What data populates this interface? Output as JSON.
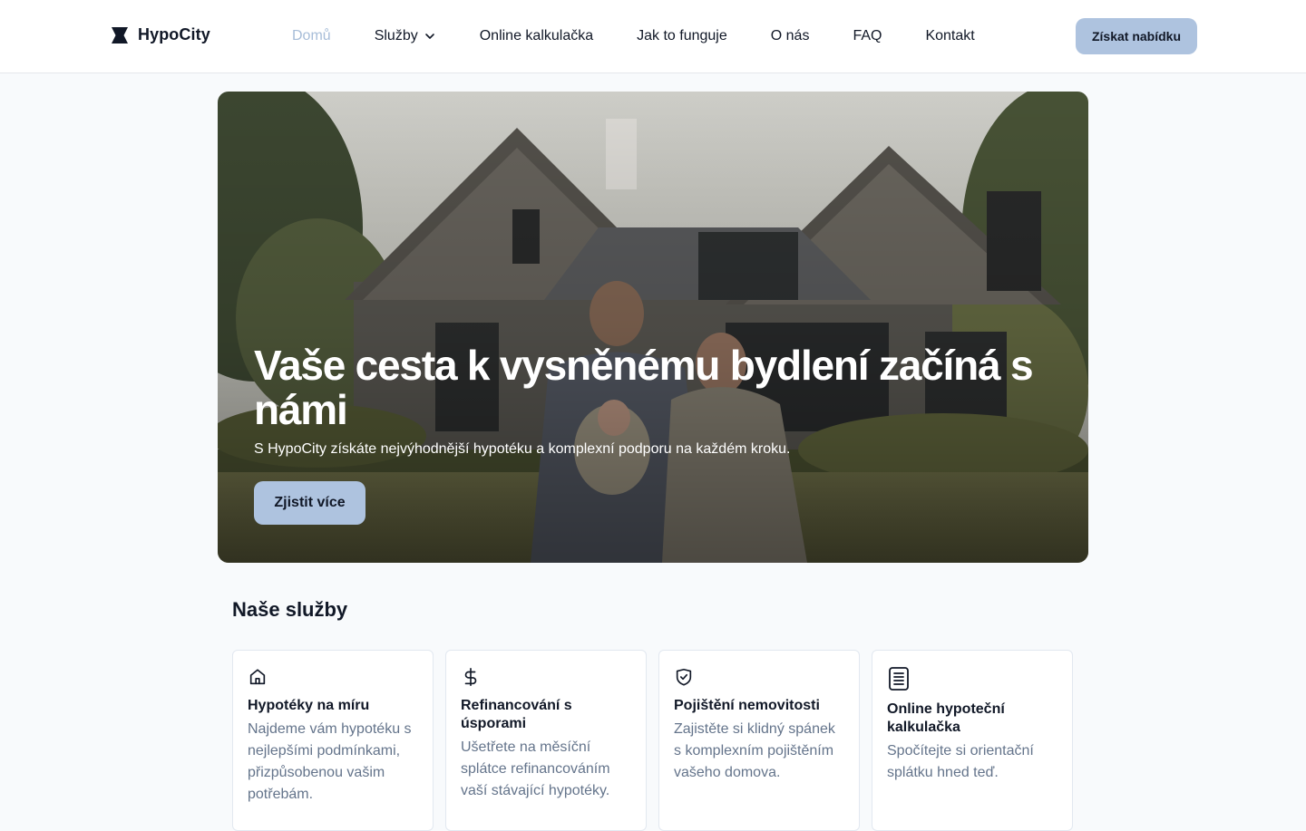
{
  "header": {
    "logo_text": "HypoCity",
    "nav": [
      {
        "label": "Domů",
        "active": true
      },
      {
        "label": "Služby",
        "has_dropdown": true
      },
      {
        "label": "Online kalkulačka"
      },
      {
        "label": "Jak to funguje"
      },
      {
        "label": "O nás"
      },
      {
        "label": "FAQ"
      },
      {
        "label": "Kontakt"
      }
    ],
    "cta_label": "Získat nabídku"
  },
  "hero": {
    "title": "Vaše cesta k vysněnému bydlení začíná s námi",
    "subtitle": "S HypoCity získáte nejvýhodnější hypotéku a komplexní podporu na každém kroku.",
    "button_label": "Zjistit více"
  },
  "services": {
    "title": "Naše služby",
    "cards": [
      {
        "icon": "home-icon",
        "title": "Hypotéky na míru",
        "description": "Najdeme vám hypotéku s nejlepšími podmínkami, přizpůsobenou vašim potřebám."
      },
      {
        "icon": "dollar-icon",
        "title": "Refinancování s úsporami",
        "description": "Ušetřete na měsíční splátce refinancováním vaší stávající hypotéky."
      },
      {
        "icon": "shield-check-icon",
        "title": "Pojištění nemovitosti",
        "description": "Zajistěte si klidný spánek s komplexním pojištěním vašeho domova."
      },
      {
        "icon": "document-icon",
        "title": "Online hypoteční kalkulačka",
        "description": "Spočítejte si orientační splátku hned teď."
      }
    ]
  },
  "colors": {
    "accent": "#aec3df",
    "nav_active": "#a7bdd8",
    "muted_text": "#64748b"
  }
}
